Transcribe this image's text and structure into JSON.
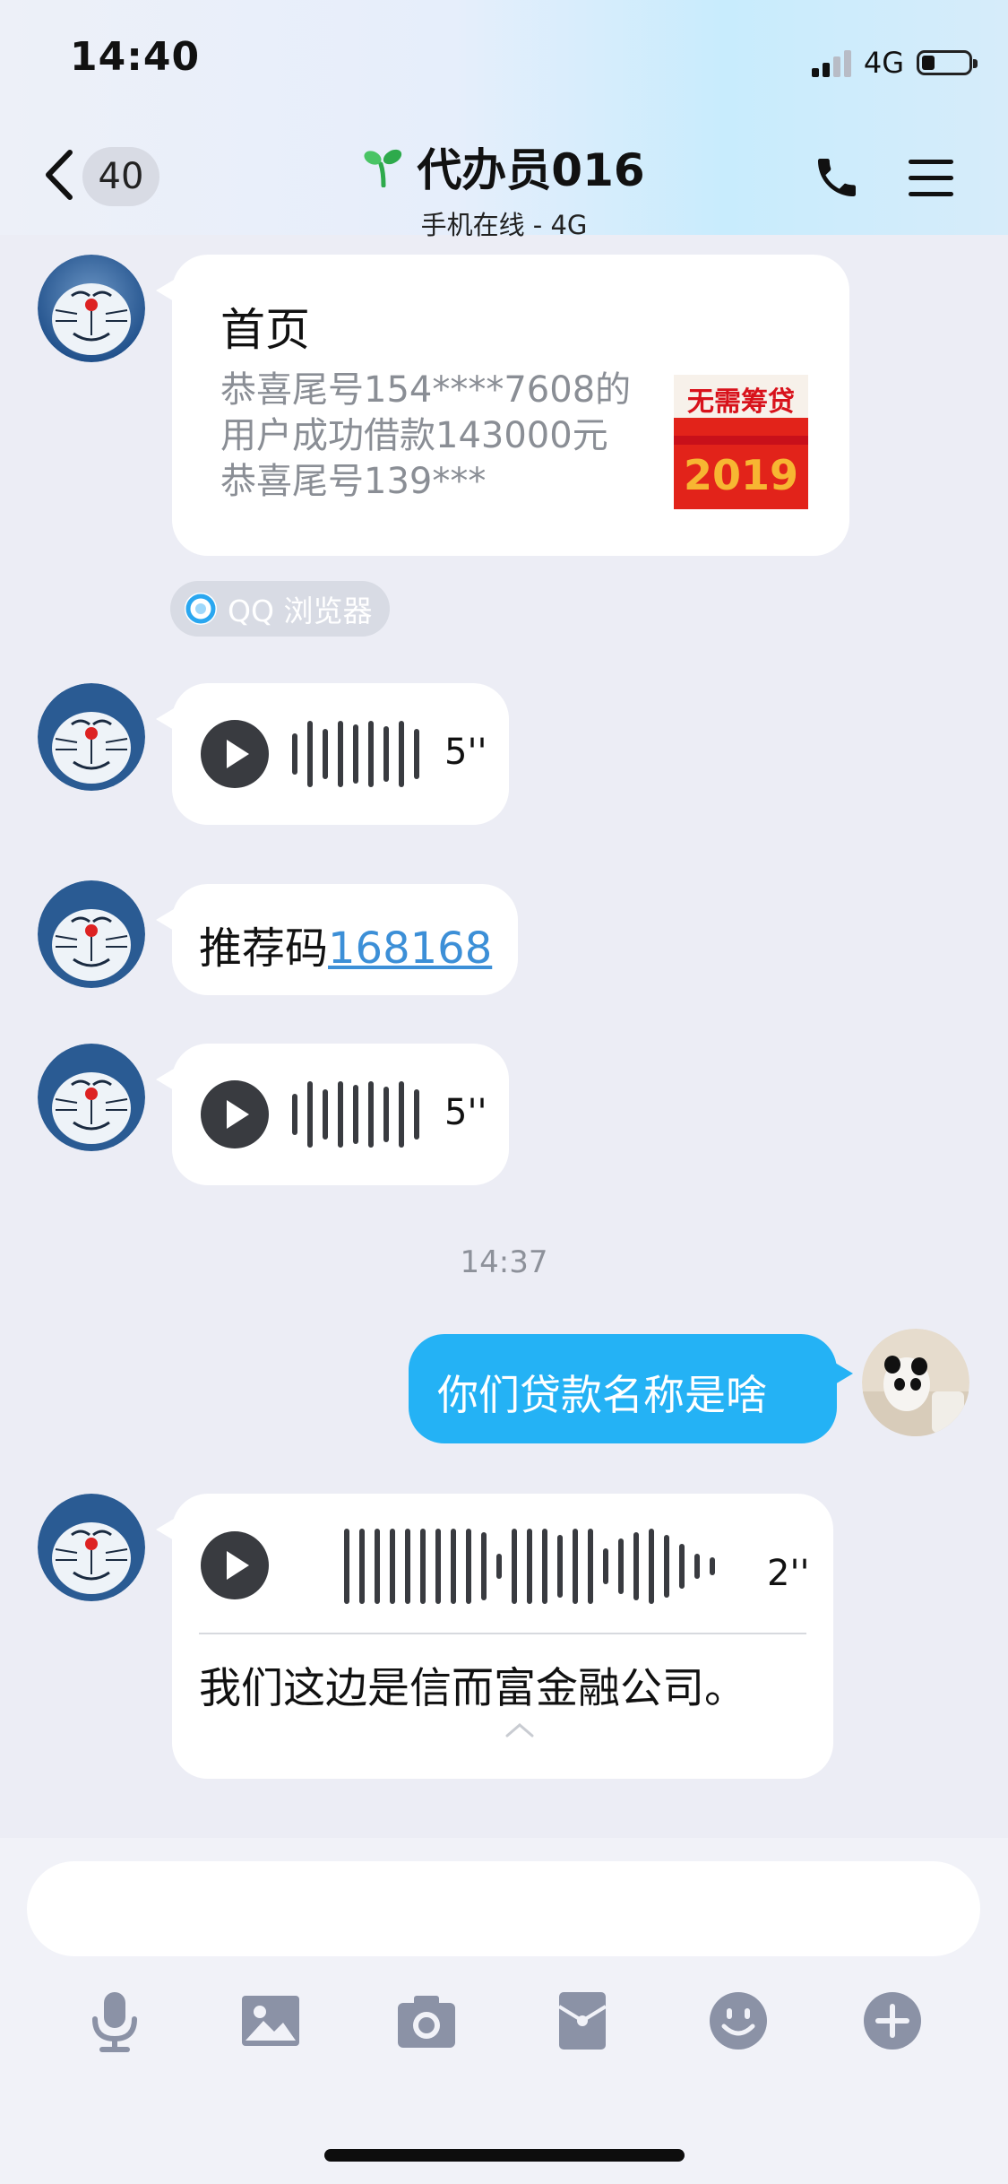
{
  "status_bar": {
    "time": "14:40",
    "network": "4G",
    "signal_bars_filled": 2,
    "signal_bars_total": 4,
    "battery_level": 0.25
  },
  "header": {
    "unread_count": "40",
    "title": "代办员016",
    "subtitle": "手机在线 - 4G"
  },
  "messages": {
    "card": {
      "title": "首页",
      "description": "恭喜尾号154****7608的用户成功借款143000元 恭喜尾号139***",
      "thumb_line1": "无需筹贷",
      "thumb_line2": "2019",
      "source": "QQ 浏览器"
    },
    "voice1": {
      "duration": "5''"
    },
    "referral": {
      "text": "推荐码",
      "code": "168168"
    },
    "voice2": {
      "duration": "5''"
    },
    "timestamp": "14:37",
    "outgoing": {
      "text": "你们贷款名称是啥"
    },
    "voice3": {
      "duration": "2''",
      "transcript": "我们这边是信而富金融公司。"
    }
  },
  "colors": {
    "outgoing_bubble": "#24b2f5",
    "link": "#3c8fd7",
    "background": "#ecedf5"
  },
  "toolbar_icons": [
    "microphone-icon",
    "image-icon",
    "camera-icon",
    "red-packet-icon",
    "emoji-icon",
    "plus-icon"
  ]
}
